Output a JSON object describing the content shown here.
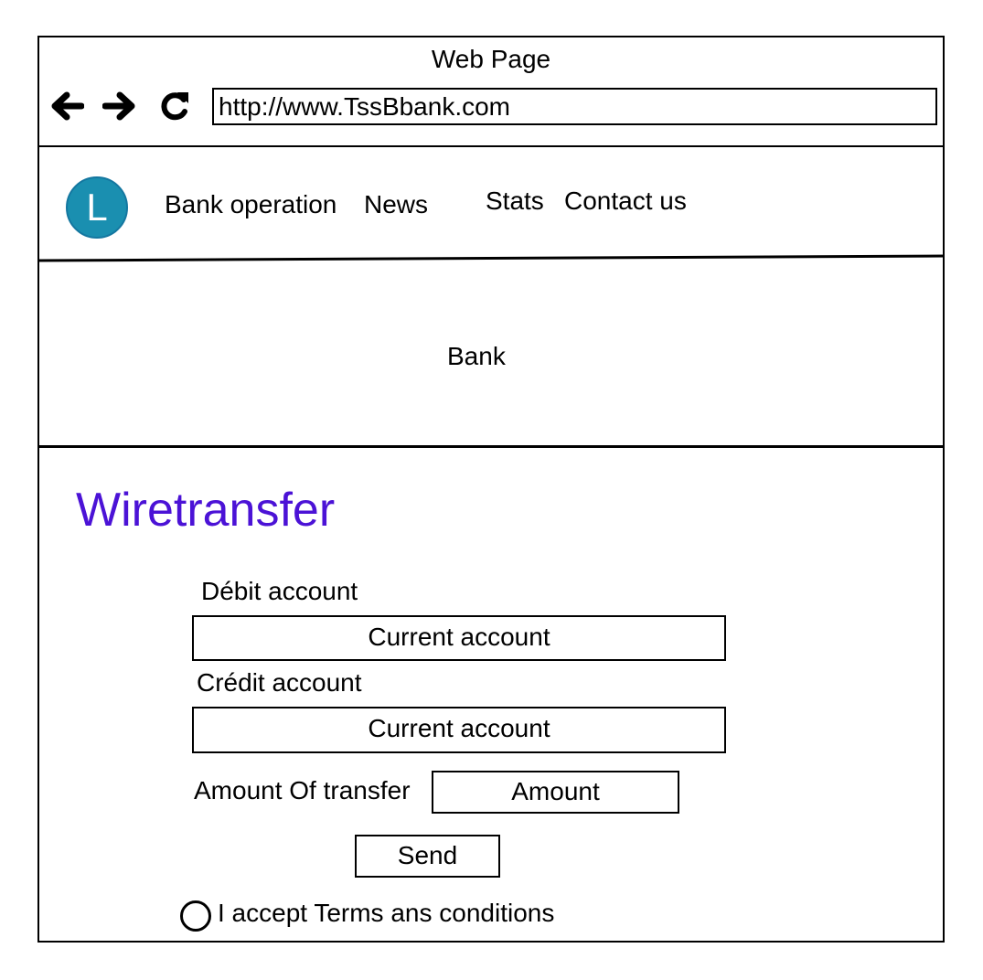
{
  "window": {
    "title": "Web Page"
  },
  "browser": {
    "url": "http://www.TssBbank.com",
    "icons": {
      "back": "arrow-left-icon",
      "forward": "arrow-right-icon",
      "reload": "reload-icon"
    }
  },
  "header": {
    "logo_letter": "L",
    "logo_color": "#1a8fb0",
    "nav": [
      "Bank operation",
      "News",
      "Stats",
      "Contact us"
    ]
  },
  "hero": {
    "text": "Bank"
  },
  "form": {
    "title": "Wiretransfer",
    "title_color": "#4b12d6",
    "debit_label": "Débit account",
    "debit_value": "Current account",
    "credit_label": "Crédit account",
    "credit_value": "Current account",
    "amount_label": "Amount Of transfer",
    "amount_placeholder": "Amount",
    "send_label": "Send",
    "terms_label": "I accept Terms ans conditions"
  }
}
